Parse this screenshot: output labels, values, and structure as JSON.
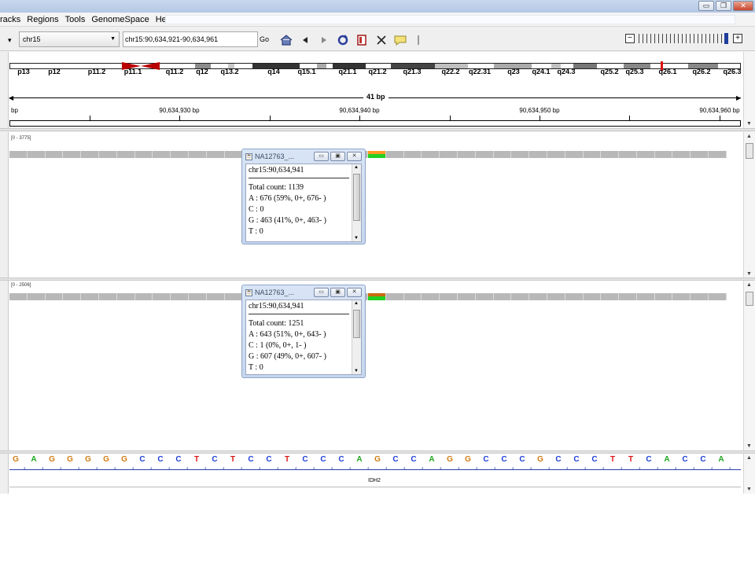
{
  "menu": [
    "racks",
    "Regions",
    "Tools",
    "GenomeSpace",
    "Help"
  ],
  "window_buttons": [
    "▭",
    "❐",
    "✕"
  ],
  "toolbar": {
    "genome_arrow": "▾",
    "chromosome": "chr15",
    "locus": "chr15:90,634,921-90,634,961",
    "go_label": "Go",
    "zoom_minus": "−",
    "zoom_plus": "+"
  },
  "ideogram": {
    "bands": [
      "p13",
      "p12",
      "p11.2",
      "p11.1",
      "q11.2",
      "q12",
      "q13.2",
      "q14",
      "q15.1",
      "q21.1",
      "q21.2",
      "q21.3",
      "q22.2",
      "q22.31",
      "q23",
      "q24.1",
      "q24.3",
      "q25.2",
      "q25.3",
      "q26.1",
      "q26.2",
      "q26.3"
    ]
  },
  "ruler": {
    "span": "41 bp",
    "unit": "bp",
    "ticks": [
      "90,634,930 bp",
      "90,634,940 bp",
      "90,634,950 bp",
      "90,634,960 bp"
    ]
  },
  "tracks": [
    {
      "range": "[0 - 3775]",
      "highlight": [
        "#ff9922",
        "#22d022"
      ],
      "popup": {
        "title": "NA12763_...",
        "position": "chr15:90,634,941",
        "total": "Total count: 1139",
        "a": "A : 676 (59%, 0+, 676- )",
        "c": "C : 0",
        "g": "G : 463 (41%, 0+, 463- )",
        "t": "T : 0"
      }
    },
    {
      "range": "[0 - 2506]",
      "highlight": [
        "#c86a10",
        "#22d022"
      ],
      "popup": {
        "title": "NA12763_...",
        "position": "chr15:90,634,941",
        "total": "Total count: 1251",
        "a": "A : 643 (51%, 0+, 643- )",
        "c": "C : 1 (0%, 0+, 1- )",
        "g": "G : 607 (49%, 0+, 607- )",
        "t": "T : 0"
      }
    }
  ],
  "sequence": [
    "G",
    "A",
    "G",
    "G",
    "G",
    "G",
    "G",
    "C",
    "C",
    "C",
    "T",
    "C",
    "T",
    "C",
    "C",
    "T",
    "C",
    "C",
    "C",
    "A",
    "G",
    "C",
    "C",
    "A",
    "G",
    "G",
    "C",
    "C",
    "C",
    "G",
    "C",
    "C",
    "C",
    "T",
    "T",
    "C",
    "A",
    "C",
    "C",
    "A"
  ],
  "base_colors": {
    "A": "#21a821",
    "C": "#1e3fd8",
    "G": "#d17b10",
    "T": "#dd1414"
  },
  "gene": "IDH2"
}
